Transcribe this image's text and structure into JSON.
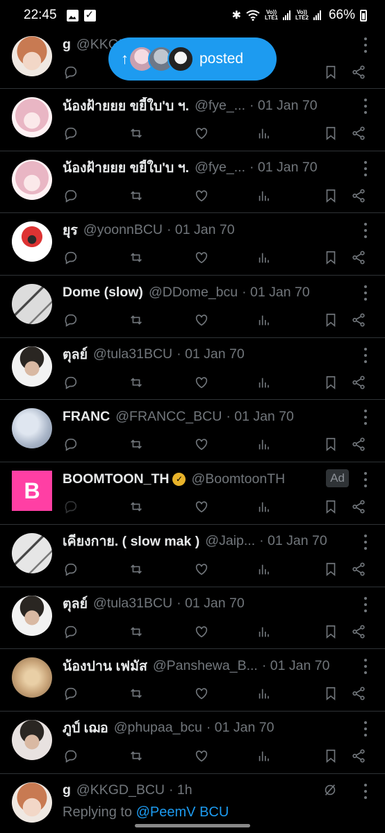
{
  "status_bar": {
    "time": "22:45",
    "battery": "66%",
    "icons": [
      "gallery-icon",
      "check-icon",
      "bluetooth-icon",
      "wifi-icon",
      "signal-icon",
      "battery-icon"
    ],
    "sim1": "Vo)) LTE1",
    "sim2": "Vo)) LTE2"
  },
  "new_posts_pill": {
    "label": "posted",
    "color": "#1d9bf0"
  },
  "feed": [
    {
      "name": "g",
      "handle": "@KKGD_BCU",
      "date": "",
      "avatar_color": "#c87a52",
      "avatar_style": "person-redhair",
      "partial": true
    },
    {
      "name": "น้องฝ้ายยย ขยี้ใบ'บ ฯ.",
      "handle": "@fye_...",
      "date": "· 01 Jan 70",
      "avatar_color": "#e9b6c4",
      "avatar_style": "person-pinkhair"
    },
    {
      "name": "น้องฝ้ายยย ขยี้ใบ'บ ฯ.",
      "handle": "@fye_...",
      "date": "· 01 Jan 70",
      "avatar_color": "#e9b6c4",
      "avatar_style": "person-pinkhair"
    },
    {
      "name": "ยุร",
      "handle": "@yoonnBCU",
      "date": "· 01 Jan 70",
      "avatar_color": "#ffffff",
      "avatar_style": "cartoon-red"
    },
    {
      "name": "Dome (slow)",
      "handle": "@DDome_bcu",
      "date": "· 01 Jan 70",
      "avatar_color": "#dcdcdc",
      "avatar_style": "sketch"
    },
    {
      "name": "ตุลย์",
      "handle": "@tula31BCU",
      "date": "· 01 Jan 70",
      "avatar_color": "#f2f2f2",
      "avatar_style": "person-dark"
    },
    {
      "name": "FRANC",
      "handle": "@FRANCC_BCU",
      "date": "· 01 Jan 70",
      "avatar_color": "#aab6c8",
      "avatar_style": "blur-blue"
    },
    {
      "name": "BOOMTOON_TH",
      "handle": "@BoomtoonTH",
      "date": "",
      "ad": "Ad",
      "verified": true,
      "avatar_color": "#ff3fa4",
      "avatar_style": "logo-b"
    },
    {
      "name": "เคียงกาย. ( slow mak )",
      "handle": "@Jaip...",
      "date": "· 01 Jan 70",
      "avatar_color": "#e6e6e6",
      "avatar_style": "sketch"
    },
    {
      "name": "ตุลย์",
      "handle": "@tula31BCU",
      "date": "· 01 Jan 70",
      "avatar_color": "#f2f2f2",
      "avatar_style": "person-dark"
    },
    {
      "name": "น้องปาน เฟมัส",
      "handle": "@Panshewa_B...",
      "date": "· 01 Jan 70",
      "avatar_color": "#c9a57a",
      "avatar_style": "blur-brown"
    },
    {
      "name": "ภูป์ เฌอ",
      "handle": "@phupaa_bcu",
      "date": "· 01 Jan 70",
      "avatar_color": "#e8e2e0",
      "avatar_style": "person-dark"
    },
    {
      "name": "g",
      "handle": "@KKGD_BCU",
      "date": "· 1h",
      "avatar_color": "#c87a52",
      "avatar_style": "person-redhair",
      "reply_prefix": "Replying to",
      "reply_to": "@PeemV BCU",
      "last": true
    }
  ],
  "action_icons": [
    "reply-icon",
    "retweet-icon",
    "like-icon",
    "views-icon",
    "bookmark-icon",
    "share-icon"
  ]
}
